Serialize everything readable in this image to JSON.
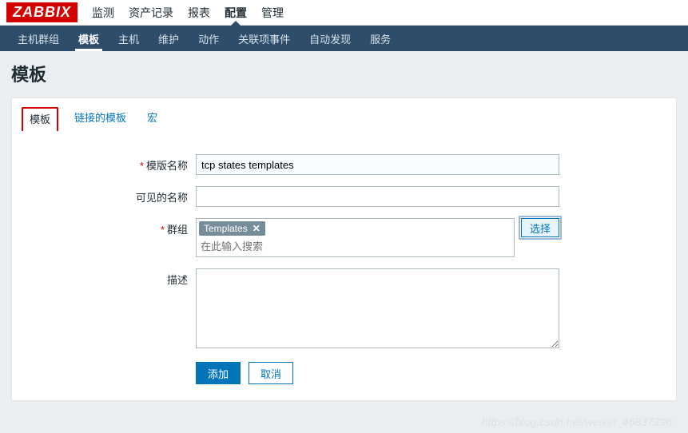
{
  "logo": "ZABBIX",
  "top_nav": {
    "items": [
      "监测",
      "资产记录",
      "报表",
      "配置",
      "管理"
    ],
    "active_index": 3
  },
  "sub_nav": {
    "items": [
      "主机群组",
      "模板",
      "主机",
      "维护",
      "动作",
      "关联项事件",
      "自动发现",
      "服务"
    ],
    "active_index": 1
  },
  "page_title": "模板",
  "tabs": {
    "items": [
      "模板",
      "链接的模板",
      "宏"
    ],
    "active_index": 0
  },
  "form": {
    "template_name": {
      "label": "模版名称",
      "value": "tcp states templates",
      "required": true
    },
    "visible_name": {
      "label": "可见的名称",
      "value": "",
      "required": false
    },
    "groups": {
      "label": "群组",
      "required": true,
      "selected": [
        {
          "name": "Templates"
        }
      ],
      "search_placeholder": "在此输入搜索",
      "select_button": "选择"
    },
    "description": {
      "label": "描述",
      "value": ""
    },
    "actions": {
      "submit": "添加",
      "cancel": "取消"
    }
  },
  "watermark": "https://blog.csdn.net/weixin_46837396"
}
